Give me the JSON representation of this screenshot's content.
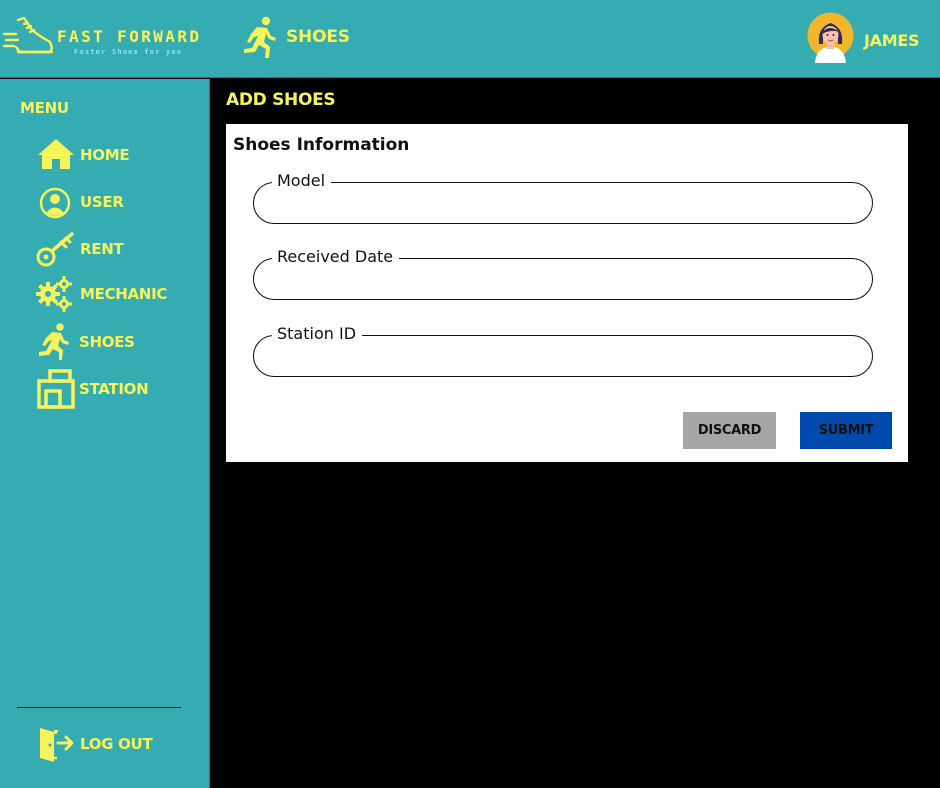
{
  "brand": {
    "title": "FAST FORWARD",
    "tagline": "Faster Shoes for you"
  },
  "header": {
    "page_label": "SHOES",
    "user_name": "JAMES"
  },
  "sidebar": {
    "heading": "MENU",
    "items": [
      {
        "label": "HOME",
        "icon": "home-icon"
      },
      {
        "label": "USER",
        "icon": "user-icon"
      },
      {
        "label": "RENT",
        "icon": "key-icon"
      },
      {
        "label": "MECHANIC",
        "icon": "gears-icon"
      },
      {
        "label": "SHOES",
        "icon": "runner-icon"
      },
      {
        "label": "STATION",
        "icon": "station-icon"
      }
    ],
    "logout": {
      "label": "LOG OUT",
      "icon": "logout-icon"
    }
  },
  "main": {
    "title": "ADD SHOES",
    "form": {
      "title": "Shoes Information",
      "fields": [
        {
          "label": "Model",
          "value": ""
        },
        {
          "label": "Received Date",
          "value": ""
        },
        {
          "label": "Station ID",
          "value": ""
        }
      ],
      "discard_label": "DISCARD",
      "submit_label": "SUBMIT"
    }
  },
  "colors": {
    "teal": "#35abb2",
    "accent_yellow": "#f7f35b",
    "background": "#000000",
    "discard_gray": "#a6a6a6",
    "submit_blue": "#004aad"
  }
}
